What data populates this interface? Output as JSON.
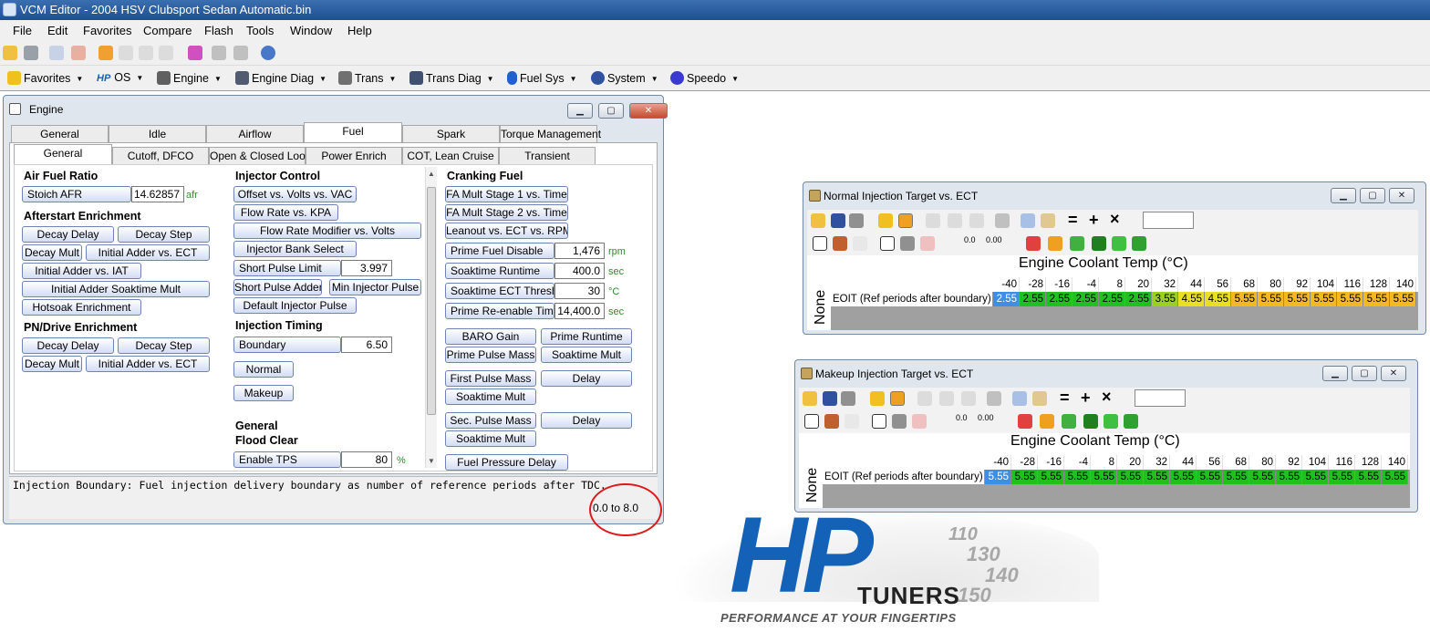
{
  "app": {
    "title": "VCM Editor - 2004 HSV Clubsport Sedan Automatic.bin"
  },
  "menu": [
    "File",
    "Edit",
    "Favorites",
    "Compare",
    "Flash",
    "Tools",
    "Window",
    "Help"
  ],
  "nav": {
    "favorites": "Favorites",
    "os": "OS",
    "engine": "Engine",
    "engine_diag": "Engine Diag",
    "trans": "Trans",
    "trans_diag": "Trans Diag",
    "fuel_sys": "Fuel Sys",
    "system": "System",
    "speedo": "Speedo",
    "os_badge": "HP"
  },
  "engine": {
    "title": "Engine",
    "tabs": [
      "General",
      "Idle",
      "Airflow",
      "Fuel",
      "Spark",
      "Torque Management"
    ],
    "subtabs": [
      "General",
      "Cutoff, DFCO",
      "Open & Closed Loop",
      "Power Enrich",
      "COT, Lean Cruise",
      "Transient"
    ],
    "col1": {
      "afr_title": "Air Fuel Ratio",
      "stoich_label": "Stoich AFR",
      "stoich_value": "14.62857",
      "stoich_unit": "afr",
      "afterstart_title": "Afterstart Enrichment",
      "decay_delay": "Decay Delay",
      "decay_step": "Decay Step",
      "decay_mult": "Decay Mult",
      "initial_adder_ect": "Initial Adder vs. ECT",
      "initial_adder_iat": "Initial Adder vs. IAT",
      "initial_adder_soak": "Initial Adder Soaktime Mult",
      "hotsoak": "Hotsoak Enrichment",
      "pn_title": "PN/Drive Enrichment",
      "pn_decay_delay": "Decay Delay",
      "pn_decay_step": "Decay Step",
      "pn_decay_mult": "Decay Mult",
      "pn_initial_adder_ect": "Initial Adder vs. ECT"
    },
    "col2": {
      "injector_title": "Injector Control",
      "offset": "Offset vs. Volts vs. VAC",
      "flow_rate": "Flow Rate vs. KPA",
      "flow_modifier": "Flow Rate Modifier vs. Volts",
      "bank_select": "Injector Bank Select",
      "short_pulse_limit": "Short Pulse Limit",
      "short_pulse_limit_value": "3.997",
      "short_pulse_adder": "Short Pulse Adder",
      "min_injector_pulse": "Min Injector Pulse",
      "default_injector_pulse": "Default Injector Pulse",
      "timing_title": "Injection Timing",
      "boundary": "Boundary",
      "boundary_value": "6.50",
      "normal": "Normal",
      "makeup": "Makeup",
      "general_title": "General",
      "flood_title": "Flood Clear",
      "enable_tps": "Enable TPS",
      "enable_tps_value": "80",
      "enable_tps_unit": "%"
    },
    "col3": {
      "cranking_title": "Cranking Fuel",
      "fa1": "FA Mult Stage 1 vs. Time",
      "fa2": "FA Mult Stage 2 vs. Time",
      "leanout": "Leanout vs. ECT vs. RPM",
      "prime_disable": "Prime Fuel Disable",
      "prime_disable_value": "1,476",
      "prime_disable_unit": "rpm",
      "soak_runtime": "Soaktime Runtime",
      "soak_runtime_value": "400.0",
      "soak_runtime_unit": "sec",
      "soak_ect": "Soaktime ECT Thresh",
      "soak_ect_value": "30",
      "soak_ect_unit": "°C",
      "prime_reenable": "Prime Re-enable Time",
      "prime_reenable_value": "14,400.0",
      "prime_reenable_unit": "sec",
      "baro_gain": "BARO Gain",
      "prime_runtime": "Prime Runtime",
      "prime_pulse_mass": "Prime Pulse Mass",
      "soaktime_mult": "Soaktime Mult",
      "first_pulse_mass": "First Pulse Mass",
      "delay": "Delay",
      "soaktime_mult2": "Soaktime Mult",
      "sec_pulse_mass": "Sec. Pulse Mass",
      "delay2": "Delay",
      "soaktime_mult3": "Soaktime Mult",
      "fuel_pressure_delay": "Fuel Pressure Delay"
    },
    "status": "Injection Boundary: Fuel injection delivery boundary as number of reference periods after TDC.",
    "range": "0.0 to 8.0"
  },
  "normal_table": {
    "title": "Normal Injection Target vs. ECT",
    "axis_title": "Engine Coolant Temp (°C)",
    "side_label": "None",
    "row_label": "EOIT (Ref periods after boundary)",
    "columns": [
      "-40",
      "-28",
      "-16",
      "-4",
      "8",
      "20",
      "32",
      "44",
      "56",
      "68",
      "80",
      "92",
      "104",
      "116",
      "128",
      "140"
    ],
    "values": [
      "2.55",
      "2.55",
      "2.55",
      "2.55",
      "2.55",
      "2.55",
      "3.55",
      "4.55",
      "4.55",
      "5.55",
      "5.55",
      "5.55",
      "5.55",
      "5.55",
      "5.55",
      "5.55"
    ],
    "colors": [
      "#3f8ee6",
      "#20c020",
      "#20c020",
      "#20c020",
      "#20c020",
      "#20c020",
      "#9ad020",
      "#e8e020",
      "#e8e020",
      "#f4b820",
      "#f4b820",
      "#f4b820",
      "#f4b820",
      "#f4b820",
      "#f4b820",
      "#f4b820"
    ]
  },
  "makeup_table": {
    "title": "Makeup Injection Target vs. ECT",
    "axis_title": "Engine Coolant Temp (°C)",
    "side_label": "None",
    "row_label": "EOIT (Ref periods after boundary)",
    "columns": [
      "-40",
      "-28",
      "-16",
      "-4",
      "8",
      "20",
      "32",
      "44",
      "56",
      "68",
      "80",
      "92",
      "104",
      "116",
      "128",
      "140"
    ],
    "values": [
      "5.55",
      "5.55",
      "5.55",
      "5.55",
      "5.55",
      "5.55",
      "5.55",
      "5.55",
      "5.55",
      "5.55",
      "5.55",
      "5.55",
      "5.55",
      "5.55",
      "5.55",
      "5.55"
    ],
    "colors": [
      "#3f8ee6",
      "#20c020",
      "#20c020",
      "#20c020",
      "#20c020",
      "#20c020",
      "#20c020",
      "#20c020",
      "#20c020",
      "#20c020",
      "#20c020",
      "#20c020",
      "#20c020",
      "#20c020",
      "#20c020",
      "#20c020"
    ]
  },
  "table_toolbar": {
    "eq": "=",
    "plus": "+",
    "times": "×",
    "d1": "0.0",
    "d2": "0.00"
  },
  "logo": {
    "hp": "HP",
    "tuners": "TUNERS",
    "tagline": "PERFORMANCE AT YOUR FINGERTIPS",
    "dial": [
      "110",
      "130",
      "140",
      "150"
    ]
  }
}
